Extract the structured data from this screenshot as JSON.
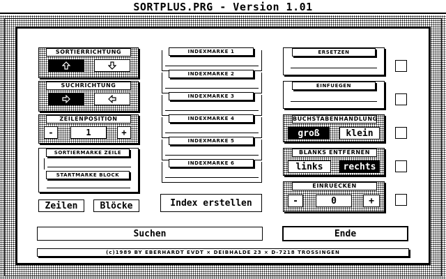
{
  "window": {
    "title": "SORTPLUS.PRG - Version 1.01"
  },
  "sort_direction": {
    "header": "SORTIERRICHTUNG",
    "up_icon": "arrow-up-outline",
    "down_icon": "arrow-down-outline",
    "selected": "up"
  },
  "search_direction": {
    "header": "SUCHRICHTUNG",
    "right_icon": "arrow-right-outline",
    "left_icon": "arrow-left-outline",
    "selected": "right"
  },
  "line_position": {
    "header": "ZEILENPOSITION",
    "minus": "-",
    "value": "1",
    "plus": "+"
  },
  "markers": {
    "sort_line_label": "SORTIERMARKE ZEILE",
    "start_block_label": "STARTMARKE BLOCK"
  },
  "mode_buttons": {
    "lines": "Zeilen",
    "blocks": "Blöcke"
  },
  "index_marks": [
    "INDEXMARKE 1",
    "INDEXMARKE 2",
    "INDEXMARKE 3",
    "INDEXMARKE 4",
    "INDEXMARKE 5",
    "INDEXMARKE 6"
  ],
  "create_index": "Index erstellen",
  "replace": {
    "label": "ERSETZEN"
  },
  "insert": {
    "label": "EINFUEGEN"
  },
  "case_handling": {
    "header": "BUCHSTABENHANDLUNG",
    "upper": "groß",
    "lower": "klein",
    "selected": "upper"
  },
  "strip_blanks": {
    "header": "BLANKS ENTFERNEN",
    "left": "links",
    "right": "rechts",
    "selected": "right"
  },
  "indent": {
    "header": "EINRUECKEN",
    "minus": "-",
    "value": "0",
    "plus": "+"
  },
  "actions": {
    "search": "Suchen",
    "end": "Ende"
  },
  "footer": "(c)1989 BY EBERHARDT EVDT × DEIBHALDE 23 × D-7218 TROSSINGEN"
}
